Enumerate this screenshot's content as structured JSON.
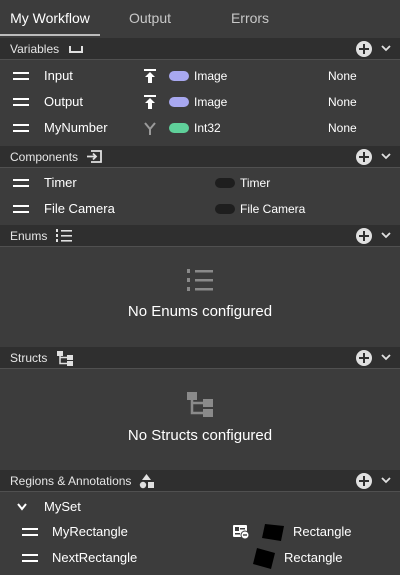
{
  "tabs": [
    "My Workflow",
    "Output",
    "Errors"
  ],
  "variables": {
    "title": "Variables",
    "rows": [
      {
        "name": "Input",
        "type": "Image",
        "value": "None",
        "dir_icon": "upload-icon",
        "color": "#a8a8f0"
      },
      {
        "name": "Output",
        "type": "Image",
        "value": "None",
        "dir_icon": "upload-icon",
        "color": "#a8a8f0"
      },
      {
        "name": "MyNumber",
        "type": "Int32",
        "value": "None",
        "dir_icon": "fork-icon",
        "color": "#5fd09a"
      }
    ]
  },
  "components": {
    "title": "Components",
    "rows": [
      {
        "name": "Timer",
        "type": "Timer"
      },
      {
        "name": "File Camera",
        "type": "File Camera"
      }
    ]
  },
  "enums": {
    "title": "Enums",
    "empty": "No Enums configured"
  },
  "structs": {
    "title": "Structs",
    "empty": "No Structs configured"
  },
  "regions": {
    "title": "Regions & Annotations",
    "group": "MySet",
    "rows": [
      {
        "name": "MyRectangle",
        "type": "Rectangle"
      },
      {
        "name": "NextRectangle",
        "type": "Rectangle"
      }
    ]
  },
  "colors": {
    "background": "#3c3c3c",
    "header": "#2f2f2f",
    "image_type": "#a8a8f0",
    "int_type": "#5fd09a",
    "component_type": "#1e1e1e"
  }
}
